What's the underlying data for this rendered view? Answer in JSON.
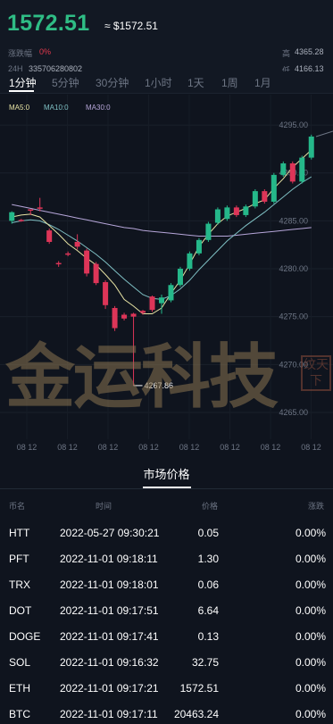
{
  "header": {
    "price": "1572.51",
    "approx": "≈ $1572.51",
    "change_label": "涨跌幅",
    "change_value": "0%",
    "vol_label": "24H",
    "vol_value": "335706280802",
    "high_label": "高",
    "high_value": "4365.28",
    "low_label": "低",
    "low_value": "4166.13"
  },
  "tabs": [
    "1分钟",
    "5分钟",
    "30分钟",
    "1小时",
    "1天",
    "1周",
    "1月"
  ],
  "ma_legend": [
    {
      "label": "MA5:0",
      "color": "#e7e3a4"
    },
    {
      "label": "MA10:0",
      "color": "#7fc0c4"
    },
    {
      "label": "MA30:0",
      "color": "#b6a6d9"
    }
  ],
  "chart_data": {
    "type": "candlestick",
    "y_ticks": [
      "4295.00",
      "4290.00",
      "4285.00",
      "4280.00",
      "4275.00",
      "4270.00",
      "4265.00"
    ],
    "x_ticks": [
      "08 12",
      "08 12",
      "08 12",
      "08 12",
      "08 12",
      "08 12",
      "08 12",
      "08 12"
    ],
    "ylim": [
      4262.2,
      4296.5
    ],
    "min_label": "4267.86",
    "colors": {
      "up": "#25b88a",
      "down": "#dd3558"
    },
    "candles": [
      {
        "o": 4285.0,
        "c": 4285.9,
        "h": 4286.0,
        "l": 4284.7
      },
      {
        "o": 4285.1,
        "c": 4285.0,
        "h": 4285.2,
        "l": 4284.9
      },
      {
        "o": 4286.2,
        "c": 4286.1,
        "h": 4286.2,
        "l": 4285.6
      },
      {
        "o": 4286.4,
        "c": 4286.3,
        "h": 4287.4,
        "l": 4286.0
      },
      {
        "o": 4284.0,
        "c": 4282.8,
        "h": 4284.2,
        "l": 4282.6
      },
      {
        "o": 4280.6,
        "c": 4280.5,
        "h": 4280.8,
        "l": 4280.2
      },
      {
        "o": 4281.6,
        "c": 4281.5,
        "h": 4281.8,
        "l": 4281.3
      },
      {
        "o": 4282.8,
        "c": 4282.3,
        "h": 4283.6,
        "l": 4282.0
      },
      {
        "o": 4281.9,
        "c": 4279.5,
        "h": 4282.1,
        "l": 4279.2
      },
      {
        "o": 4280.5,
        "c": 4278.5,
        "h": 4280.7,
        "l": 4278.3
      },
      {
        "o": 4278.6,
        "c": 4276.2,
        "h": 4278.8,
        "l": 4275.8
      },
      {
        "o": 4275.9,
        "c": 4273.8,
        "h": 4276.1,
        "l": 4273.5
      },
      {
        "o": 4275.2,
        "c": 4274.8,
        "h": 4275.4,
        "l": 4274.6
      },
      {
        "o": 4275.3,
        "c": 4275.0,
        "h": 4275.4,
        "l": 4267.8
      },
      {
        "o": 4275.6,
        "c": 4275.4,
        "h": 4275.7,
        "l": 4275.2
      },
      {
        "o": 4277.1,
        "c": 4275.7,
        "h": 4277.2,
        "l": 4275.5
      },
      {
        "o": 4276.4,
        "c": 4277.0,
        "h": 4277.3,
        "l": 4275.3
      },
      {
        "o": 4276.7,
        "c": 4278.3,
        "h": 4278.5,
        "l": 4276.5
      },
      {
        "o": 4278.3,
        "c": 4280.0,
        "h": 4280.2,
        "l": 4278.1
      },
      {
        "o": 4280.0,
        "c": 4281.6,
        "h": 4281.8,
        "l": 4279.8
      },
      {
        "o": 4281.6,
        "c": 4283.0,
        "h": 4283.2,
        "l": 4281.4
      },
      {
        "o": 4283.0,
        "c": 4284.7,
        "h": 4284.9,
        "l": 4282.8
      },
      {
        "o": 4284.8,
        "c": 4286.2,
        "h": 4286.4,
        "l": 4284.6
      },
      {
        "o": 4285.2,
        "c": 4286.4,
        "h": 4286.6,
        "l": 4285.0
      },
      {
        "o": 4286.4,
        "c": 4285.6,
        "h": 4286.6,
        "l": 4285.4
      },
      {
        "o": 4285.6,
        "c": 4286.5,
        "h": 4286.7,
        "l": 4285.4
      },
      {
        "o": 4286.5,
        "c": 4288.1,
        "h": 4288.3,
        "l": 4286.3
      },
      {
        "o": 4288.1,
        "c": 4287.0,
        "h": 4288.3,
        "l": 4286.8
      },
      {
        "o": 4287.0,
        "c": 4289.8,
        "h": 4290.0,
        "l": 4286.8
      },
      {
        "o": 4289.8,
        "c": 4291.0,
        "h": 4291.2,
        "l": 4289.6
      },
      {
        "o": 4291.0,
        "c": 4289.1,
        "h": 4291.2,
        "l": 4288.9
      },
      {
        "o": 4289.1,
        "c": 4291.6,
        "h": 4291.8,
        "l": 4288.9
      },
      {
        "o": 4291.6,
        "c": 4293.8,
        "h": 4294.0,
        "l": 4291.4
      }
    ],
    "ma5": [
      4285.4,
      4285.6,
      4285.7,
      4285.4,
      4284.5,
      4283.6,
      4282.6,
      4281.9,
      4281.1,
      4280.4,
      4279.4,
      4278.3,
      4276.8,
      4276.1,
      4275.3,
      4275.3,
      4275.9,
      4277.4,
      4278.8,
      4280.5,
      4282.3,
      4283.6,
      4284.7,
      4285.5,
      4285.9,
      4286.3,
      4286.8,
      4287.2,
      4288.4,
      4289.4,
      4290.6,
      4291.5,
      4292.4
    ],
    "ma10": [
      4284.8,
      4285.0,
      4285.1,
      4285.0,
      4284.6,
      4284.1,
      4283.5,
      4282.9,
      4282.2,
      4281.5,
      4280.7,
      4279.8,
      4278.9,
      4278.1,
      4277.3,
      4276.9,
      4276.8,
      4277.2,
      4277.9,
      4278.8,
      4279.9,
      4280.9,
      4281.9,
      4282.9,
      4283.7,
      4284.5,
      4285.2,
      4285.9,
      4286.7,
      4287.5,
      4288.3,
      4289.0,
      4289.6
    ],
    "ma30": [
      4286.7,
      4286.5,
      4286.3,
      4286.1,
      4285.9,
      4285.7,
      4285.5,
      4285.3,
      4285.1,
      4284.9,
      4284.7,
      4284.5,
      4284.3,
      4284.2,
      4284.0,
      4283.9,
      4283.8,
      4283.7,
      4283.6,
      4283.5,
      4283.4,
      4283.4,
      4283.4,
      4283.4,
      4283.5,
      4283.6,
      4283.7,
      4283.8,
      4283.9,
      4284.0,
      4284.1,
      4284.2,
      4284.3
    ]
  },
  "watermark": {
    "text": "金运科技",
    "seal": "纹天下"
  },
  "market": {
    "title": "市场价格",
    "headers": {
      "name": "币名",
      "time": "时间",
      "price": "价格",
      "change": "涨跌"
    },
    "rows": [
      {
        "name": "HTT",
        "time": "2022-05-27 09:30:21",
        "price": "0.05",
        "change": "0.00%"
      },
      {
        "name": "PFT",
        "time": "2022-11-01 09:18:11",
        "price": "1.30",
        "change": "0.00%"
      },
      {
        "name": "TRX",
        "time": "2022-11-01 09:18:01",
        "price": "0.06",
        "change": "0.00%"
      },
      {
        "name": "DOT",
        "time": "2022-11-01 09:17:51",
        "price": "6.64",
        "change": "0.00%"
      },
      {
        "name": "DOGE",
        "time": "2022-11-01 09:17:41",
        "price": "0.13",
        "change": "0.00%"
      },
      {
        "name": "SOL",
        "time": "2022-11-01 09:16:32",
        "price": "32.75",
        "change": "0.00%"
      },
      {
        "name": "ETH",
        "time": "2022-11-01 09:17:21",
        "price": "1572.51",
        "change": "0.00%"
      },
      {
        "name": "BTC",
        "time": "2022-11-01 09:17:11",
        "price": "20463.24",
        "change": "0.00%"
      }
    ]
  }
}
